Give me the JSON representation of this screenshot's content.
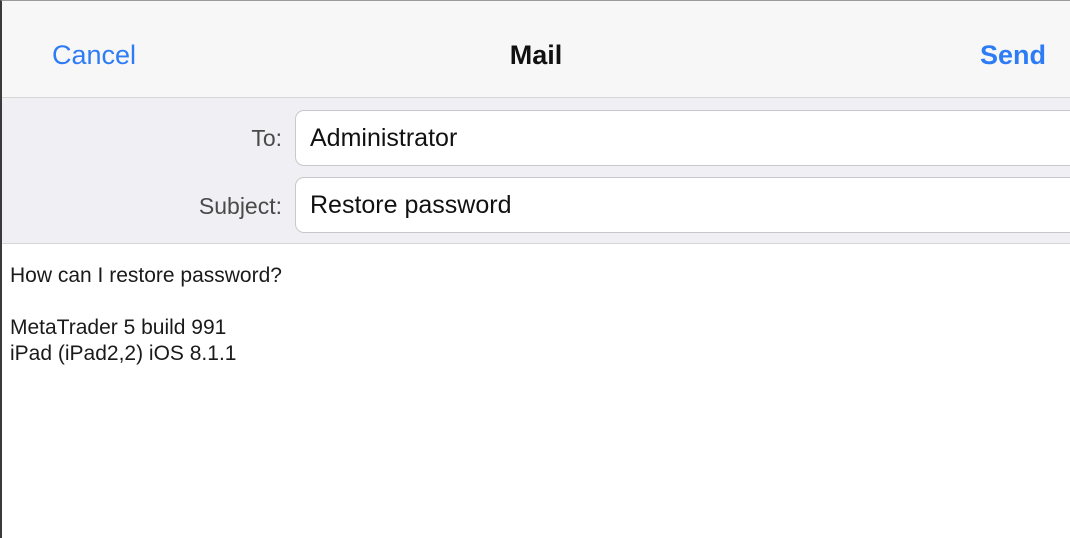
{
  "navbar": {
    "cancel_label": "Cancel",
    "title": "Mail",
    "send_label": "Send"
  },
  "fields": {
    "to_label": "To:",
    "to_value": "Administrator",
    "subject_label": "Subject:",
    "subject_value": "Restore password"
  },
  "body": {
    "lines": [
      "How can I restore password?",
      "",
      "MetaTrader 5 build 991",
      "iPad (iPad2,2) iOS 8.1.1"
    ]
  },
  "colors": {
    "accent": "#2d7cf6",
    "header_bg": "#efeff4",
    "navbar_bg": "#f7f7f7"
  }
}
